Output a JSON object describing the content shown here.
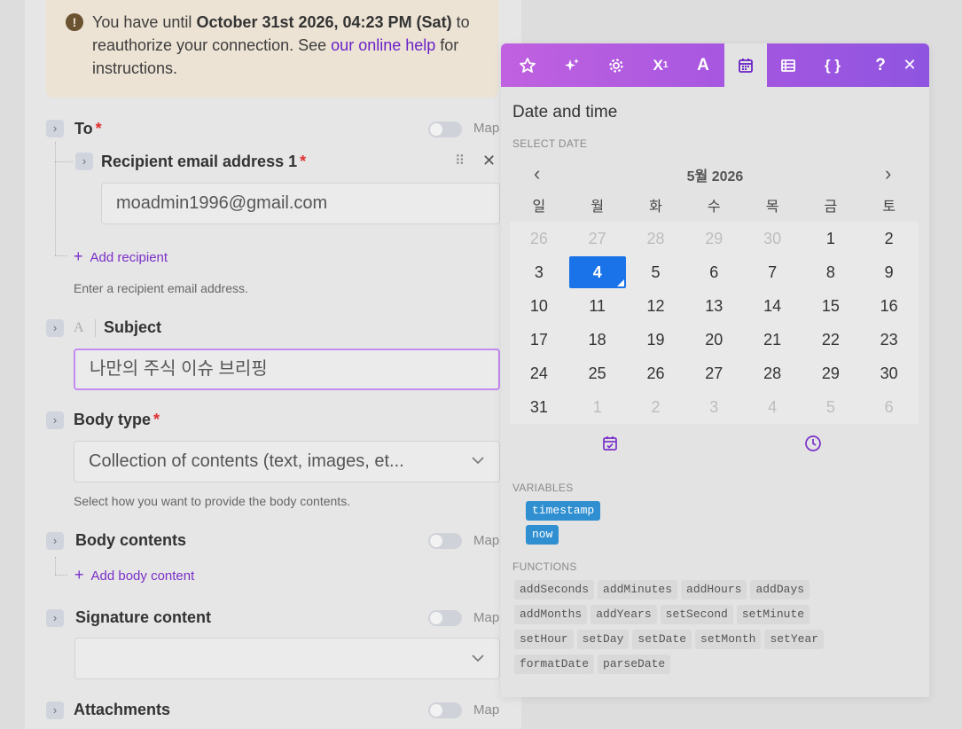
{
  "notice": {
    "text_1": "You have until ",
    "deadline": "October 31st 2026, 04:23 PM (Sat)",
    "text_2": " to reauthorize your connection. See ",
    "link": "our online help",
    "text_3": " for instructions."
  },
  "form": {
    "to": {
      "label": "To",
      "required": "*",
      "map": "Map"
    },
    "recipient": {
      "label": "Recipient email address 1",
      "required": "*",
      "value": "moadmin1996@gmail.com",
      "add": "Add recipient",
      "help": "Enter a recipient email address."
    },
    "subject": {
      "type_glyph": "A",
      "label": "Subject",
      "value": "나만의 주식 이슈 브리핑"
    },
    "body_type": {
      "label": "Body type",
      "required": "*",
      "value": "Collection of contents (text, images, et...",
      "help": "Select how you want to provide the body contents."
    },
    "body_contents": {
      "label": "Body contents",
      "map": "Map",
      "add": "Add body content"
    },
    "signature": {
      "label": "Signature content",
      "map": "Map",
      "value": ""
    },
    "attachments": {
      "label": "Attachments",
      "map": "Map"
    }
  },
  "popover": {
    "toolbar_icons": [
      "star-icon",
      "sparkle-icon",
      "gear-icon",
      "superscript-icon",
      "text-icon",
      "calendar-icon",
      "table-icon",
      "braces-icon",
      "help-icon",
      "close-icon"
    ],
    "active_tab": "calendar-icon",
    "title": "Date and time",
    "select_date_label": "SELECT DATE",
    "calendar": {
      "month": "5월 2026",
      "weekdays": [
        "일",
        "월",
        "화",
        "수",
        "목",
        "금",
        "토"
      ],
      "weeks": [
        [
          "26",
          "27",
          "28",
          "29",
          "30",
          "1",
          "2"
        ],
        [
          "3",
          "4",
          "5",
          "6",
          "7",
          "8",
          "9"
        ],
        [
          "10",
          "11",
          "12",
          "13",
          "14",
          "15",
          "16"
        ],
        [
          "17",
          "18",
          "19",
          "20",
          "21",
          "22",
          "23"
        ],
        [
          "24",
          "25",
          "26",
          "27",
          "28",
          "29",
          "30"
        ],
        [
          "31",
          "1",
          "2",
          "3",
          "4",
          "5",
          "6"
        ]
      ],
      "selected": "4"
    },
    "variables_label": "VARIABLES",
    "variables": [
      "timestamp",
      "now"
    ],
    "functions_label": "FUNCTIONS",
    "functions": [
      "addSeconds",
      "addMinutes",
      "addHours",
      "addDays",
      "addMonths",
      "addYears",
      "setSecond",
      "setMinute",
      "setHour",
      "setDay",
      "setDate",
      "setMonth",
      "setYear",
      "formatDate",
      "parseDate"
    ],
    "colors": {
      "accent": "#7a2fc8",
      "selected_day": "#1a73e8",
      "variable_chip": "#2f8fd0"
    }
  }
}
